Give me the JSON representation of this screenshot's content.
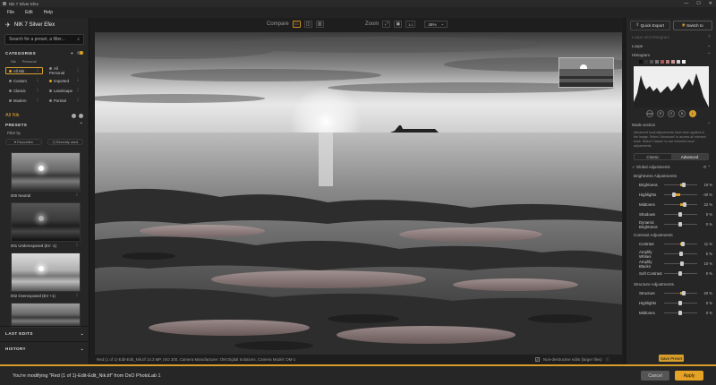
{
  "window": {
    "title": "Nik 7 Silver Efex",
    "controls": [
      "—",
      "☐",
      "✕"
    ]
  },
  "menu": [
    "File",
    "Edit",
    "Help"
  ],
  "brand": {
    "name": "NIK 7 Silver Efex"
  },
  "search": {
    "placeholder": "Search for a preset, a filter..."
  },
  "categories": {
    "title": "CATEGORIES",
    "tabs": [
      "Nik",
      "Personal"
    ],
    "items": [
      {
        "label": "All Nik",
        "selected": true
      },
      {
        "label": "All Personal",
        "selected": false
      },
      {
        "label": "Custom",
        "selected": false
      },
      {
        "label": "Imported",
        "selected": false
      },
      {
        "label": "Classic",
        "selected": false
      },
      {
        "label": "Landscape",
        "selected": false
      },
      {
        "label": "Modern",
        "selected": false
      },
      {
        "label": "Portrait",
        "selected": false
      }
    ]
  },
  "collection": {
    "label": "All Nik"
  },
  "presets": {
    "title": "PRESETS",
    "filter_label": "Filter by",
    "favourites": "Favourites",
    "recently_used": "Recently used",
    "items": [
      {
        "label": "000 Neutral",
        "tone": "mid"
      },
      {
        "label": "001 Underexposed (EV -1)",
        "tone": "dark"
      },
      {
        "label": "002 Overexposed (EV +1)",
        "tone": "light"
      },
      {
        "label": "",
        "tone": "mid"
      }
    ]
  },
  "left_footer": {
    "last_edits": "LAST EDITS",
    "history": "HISTORY"
  },
  "toolbar": {
    "compare_label": "Compare",
    "zoom_label": "Zoom",
    "zoom_one": "1:1",
    "zoom_value": "45%"
  },
  "status": {
    "info": "Red (1 of 1)-Edit-Edit_Nik.tif     14.3 MP, ISO 200, Camera Manufacturer: OM Digital Solutions, Camera Model: OM-1",
    "non_destructive": "Non-destructive edits (larger files)"
  },
  "right": {
    "quick_export": "Quick Export",
    "switch_to": "Switch to",
    "loupe_hint": "Loupe and Histogram",
    "loupe": "Loupe",
    "histogram": "Histogram",
    "channels": [
      "RGB",
      "R",
      "G",
      "B",
      "L"
    ],
    "mode_section": "Mode section",
    "mode_desc": "Advanced local adjustments have been applied to the image. Select 'Advanced' to access all relevant tools. Select 'Classic' to use inherited local adjustments.",
    "mode_tabs": [
      "Classic",
      "Advanced"
    ],
    "global_adjustments": "Global Adjustments",
    "brightness_title": "Brightness Adjustments",
    "brightness": [
      {
        "label": "Brightness",
        "value": "19 %",
        "pct": 19
      },
      {
        "label": "Highlights",
        "value": "-40 %",
        "pct": -40
      },
      {
        "label": "Midtones",
        "value": "22 %",
        "pct": 22
      },
      {
        "label": "Shadows",
        "value": "0 %",
        "pct": 0
      },
      {
        "label": "Dynamic Brightness",
        "value": "0 %",
        "pct": 0
      }
    ],
    "contrast_title": "Contrast Adjustments",
    "contrast": [
      {
        "label": "Contrast",
        "value": "11 %",
        "pct": 11
      },
      {
        "label": "Amplify Whites",
        "value": "5 %",
        "pct": 5
      },
      {
        "label": "Amplify Blacks",
        "value": "10 %",
        "pct": 10
      },
      {
        "label": "Soft Contrast",
        "value": "0 %",
        "pct": 0
      }
    ],
    "structure_title": "Structure Adjustments",
    "structure": [
      {
        "label": "Structure",
        "value": "20 %",
        "pct": 20
      },
      {
        "label": "Highlights",
        "value": "0 %",
        "pct": 0
      },
      {
        "label": "Midtones",
        "value": "0 %",
        "pct": 0
      }
    ],
    "save_preset": "Save Preset"
  },
  "bottom": {
    "message": "You're modifying \"Red (1 of 1)-Edit-Edit_Nik.tif\" from DxO PhotoLab 1",
    "cancel": "Cancel",
    "apply": "Apply"
  },
  "colors": {
    "accent": "#d89c2a",
    "panel": "#262626",
    "background": "#1b1b1b"
  }
}
